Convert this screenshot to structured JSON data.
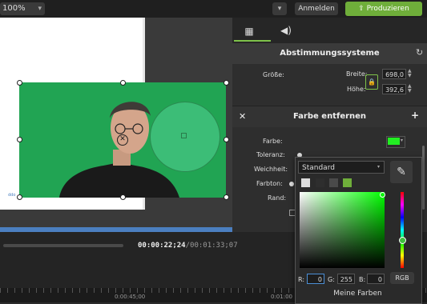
{
  "topbar": {
    "zoom_value": "100%",
    "login_label": "Anmelden",
    "produce_label": "Produzieren"
  },
  "canvas": {
    "link_text": "ddo"
  },
  "timeline": {
    "current_time": "00:00:22;24",
    "separator": "/",
    "total_time": "00:01:33;07",
    "ruler_labels": [
      "0:00:45;00",
      "0:01:00"
    ]
  },
  "properties": {
    "section_title": "Abstimmungssysteme",
    "size_label": "Größe:",
    "width_label": "Breite:",
    "width_value": "698,0",
    "height_label": "Höhe:",
    "height_value": "392,6"
  },
  "effect": {
    "title": "Farbe entfernen",
    "color_label": "Farbe:",
    "color_value": "#22ee22",
    "tolerance_label": "Toleranz:",
    "softness_label": "Weichheit:",
    "hue_label": "Farbton:",
    "edge_label": "Rand:"
  },
  "color_picker": {
    "preset_value": "Standard",
    "swatches": [
      "#dcdcdc",
      "#2e2e2e",
      "#4a4a4a",
      "#6fae3a"
    ],
    "r_label": "R:",
    "r_value": "0",
    "g_label": "G:",
    "g_value": "255",
    "b_label": "B:",
    "b_value": "0",
    "mode_button": "RGB",
    "my_colors_label": "Meine Farben"
  },
  "colors": {
    "accent": "#6fae3a",
    "green_screen": "#21a453",
    "selected_color": "#22ee22"
  }
}
